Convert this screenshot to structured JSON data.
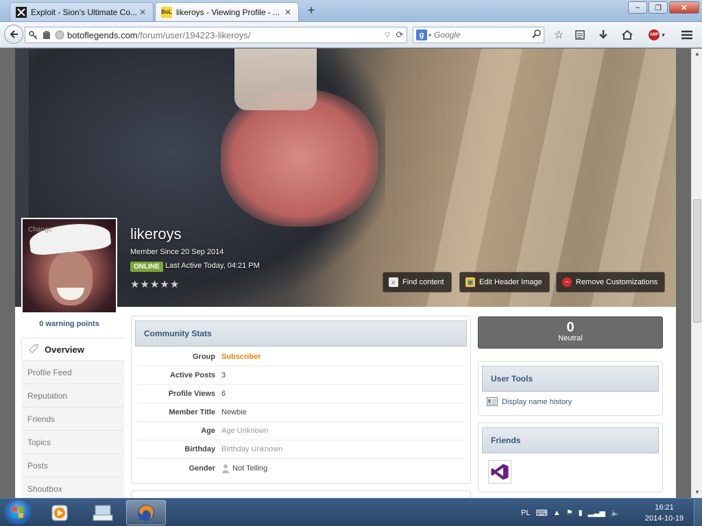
{
  "browser": {
    "tabs": [
      {
        "title": "Exploit - Sion's Ultimate Co...",
        "favicon": "bol-logo-icon",
        "active": false
      },
      {
        "title": "likeroys - Viewing Profile - ...",
        "favicon": "bol-favicon",
        "active": true
      }
    ],
    "favicon_bol_text": "BoL",
    "new_tab_glyph": "+",
    "url_host": "botoflegends.com",
    "url_path": "/forum/user/194223-likeroys/",
    "search_placeholder": "Google",
    "window_buttons": {
      "minimize": "–",
      "restore": "❐",
      "close": "✕"
    }
  },
  "profile": {
    "avatar_change": "Change",
    "name": "likeroys",
    "member_since": "Member Since 20 Sep 2014",
    "online_badge": "ONLINE",
    "last_active": "Last Active Today, 04:21 PM",
    "rating_stars": 0,
    "rating_max": 5,
    "buttons": {
      "find_content": "Find content",
      "edit_header": "Edit Header Image",
      "remove_custom": "Remove Customizations"
    },
    "warning_points": "0 warning points"
  },
  "sidenav": {
    "items": [
      "Overview",
      "Profile Feed",
      "Reputation",
      "Friends",
      "Topics",
      "Posts",
      "Shoutbox"
    ]
  },
  "community_stats": {
    "title": "Community Stats",
    "rows": [
      {
        "label": "Group",
        "value": "Subscriber"
      },
      {
        "label": "Active Posts",
        "value": "3"
      },
      {
        "label": "Profile Views",
        "value": "6"
      },
      {
        "label": "Member Title",
        "value": "Newbie"
      },
      {
        "label": "Age",
        "value": "Age Unknown"
      },
      {
        "label": "Birthday",
        "value": "Birthday Unknown"
      },
      {
        "label": "Gender",
        "value": "Not Telling"
      }
    ]
  },
  "reputation": {
    "value": "0",
    "label": "Neutral"
  },
  "user_tools": {
    "title": "User Tools",
    "link": "Display name history"
  },
  "friends_box": {
    "title": "Friends"
  },
  "taskbar": {
    "language": "PL",
    "time": "16:21",
    "date": "2014-10-19"
  },
  "colors": {
    "accent_blue": "#36577a",
    "group_orange": "#f08200",
    "online_green": "#7ba63a",
    "reputation_bg": "#6b6b6b"
  }
}
